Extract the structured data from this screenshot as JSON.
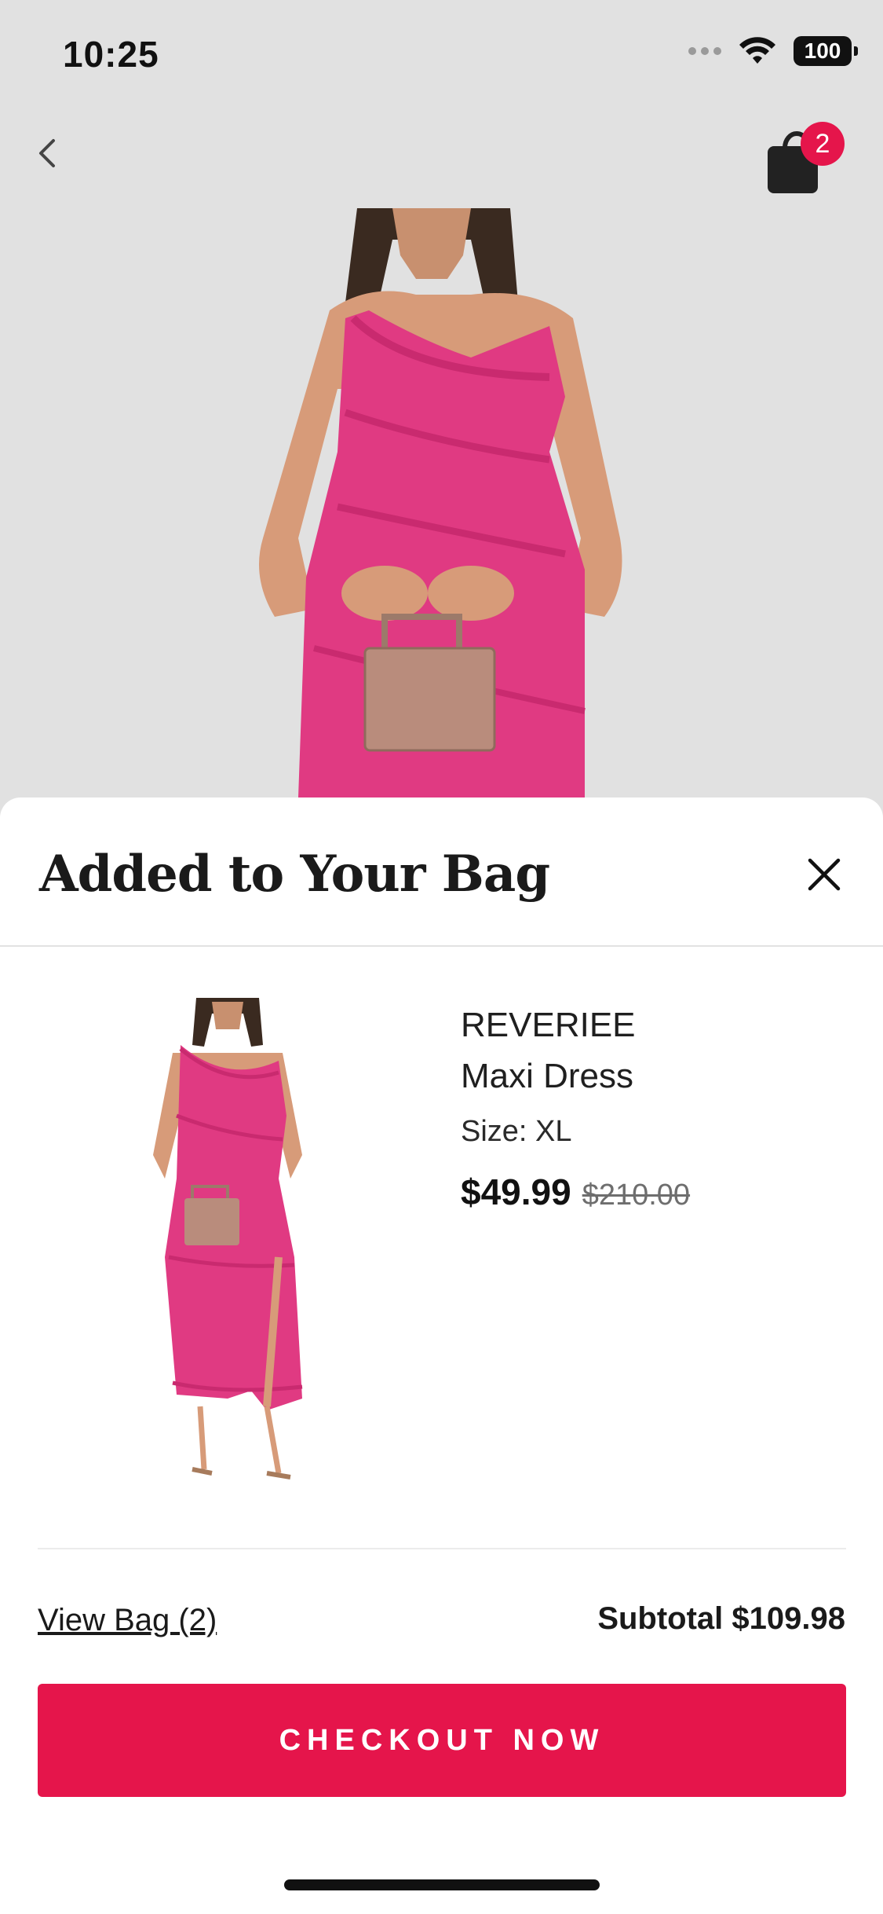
{
  "status_bar": {
    "time": "10:25",
    "battery": "100"
  },
  "nav": {
    "back_icon": "chevron-left-icon",
    "bag_icon": "shopping-bag-icon",
    "bag_count": "2"
  },
  "sheet": {
    "title": "Added to Your Bag",
    "close_icon": "close-icon"
  },
  "product": {
    "brand": "REVERIEE",
    "name": "Maxi Dress",
    "size": "Size: XL",
    "price": "$49.99",
    "original_price": "$210.00"
  },
  "footer": {
    "view_bag": "View Bag (2)",
    "subtotal": "Subtotal $109.98",
    "checkout": "CHECKOUT NOW"
  },
  "colors": {
    "accent": "#e5154b",
    "dress": "#e03a82"
  }
}
